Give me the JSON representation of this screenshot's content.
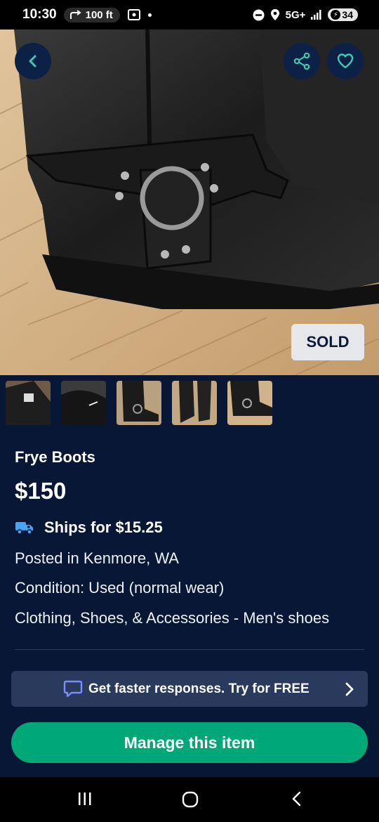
{
  "status_bar": {
    "time": "10:30",
    "nav_distance": "100 ft",
    "network": "5G+",
    "battery": "34"
  },
  "listing": {
    "sold_label": "SOLD",
    "title": "Frye Boots",
    "price": "$150",
    "shipping": "Ships for $15.25",
    "posted": "Posted in Kenmore, WA",
    "condition": "Condition: Used (normal wear)",
    "category": "Clothing, Shoes, & Accessories - Men's shoes",
    "thumbnail_count": 5
  },
  "promo": {
    "text": "Get faster responses. Try for FREE"
  },
  "actions": {
    "manage_label": "Manage this item"
  },
  "icons": {
    "back": "chevron-left-icon",
    "share": "share-icon",
    "favorite": "heart-icon",
    "shipping": "truck-icon",
    "promo": "chat-bubble-icon",
    "promo_arrow": "chevron-right-icon"
  },
  "colors": {
    "background": "#081735",
    "accent_green": "#00a878",
    "button_circle": "#0d2146",
    "icon_teal": "#3ec9b0",
    "promo_bg": "#2a3a5c",
    "chat_icon": "#7b8cff"
  }
}
